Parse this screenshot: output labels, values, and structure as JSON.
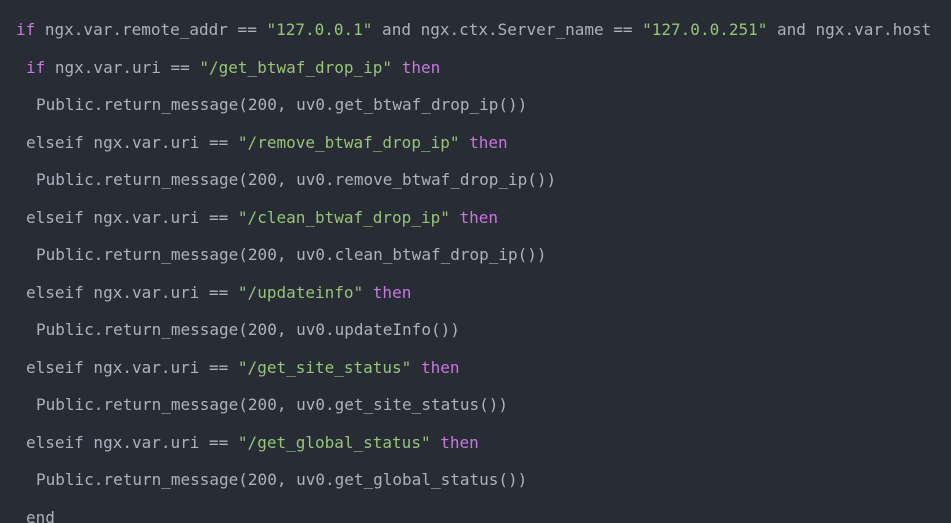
{
  "code": {
    "lines": [
      {
        "indent": 16,
        "tokens": [
          {
            "t": "kw",
            "v": "if"
          },
          {
            "t": "pl",
            "v": " ngx.var.remote_addr == "
          },
          {
            "t": "str",
            "v": "\"127.0.0.1\""
          },
          {
            "t": "pl",
            "v": " and ngx.ctx.Server_name == "
          },
          {
            "t": "str",
            "v": "\"127.0.0.251\""
          },
          {
            "t": "pl",
            "v": " and ngx.var.host"
          }
        ]
      },
      {
        "indent": 26,
        "tokens": [
          {
            "t": "kw",
            "v": "if"
          },
          {
            "t": "pl",
            "v": " ngx.var.uri == "
          },
          {
            "t": "str",
            "v": "\"/get_btwaf_drop_ip\""
          },
          {
            "t": "pl",
            "v": " "
          },
          {
            "t": "kw",
            "v": "then"
          }
        ]
      },
      {
        "indent": 36,
        "tokens": [
          {
            "t": "pl",
            "v": "Public.return_message(200, uv0.get_btwaf_drop_ip())"
          }
        ]
      },
      {
        "indent": 26,
        "tokens": [
          {
            "t": "pl",
            "v": "elseif ngx.var.uri == "
          },
          {
            "t": "str",
            "v": "\"/remove_btwaf_drop_ip\""
          },
          {
            "t": "pl",
            "v": " "
          },
          {
            "t": "kw",
            "v": "then"
          }
        ]
      },
      {
        "indent": 36,
        "tokens": [
          {
            "t": "pl",
            "v": "Public.return_message(200, uv0.remove_btwaf_drop_ip())"
          }
        ]
      },
      {
        "indent": 26,
        "tokens": [
          {
            "t": "pl",
            "v": "elseif ngx.var.uri == "
          },
          {
            "t": "str",
            "v": "\"/clean_btwaf_drop_ip\""
          },
          {
            "t": "pl",
            "v": " "
          },
          {
            "t": "kw",
            "v": "then"
          }
        ]
      },
      {
        "indent": 36,
        "tokens": [
          {
            "t": "pl",
            "v": "Public.return_message(200, uv0.clean_btwaf_drop_ip())"
          }
        ]
      },
      {
        "indent": 26,
        "tokens": [
          {
            "t": "pl",
            "v": "elseif ngx.var.uri == "
          },
          {
            "t": "str",
            "v": "\"/updateinfo\""
          },
          {
            "t": "pl",
            "v": " "
          },
          {
            "t": "kw",
            "v": "then"
          }
        ]
      },
      {
        "indent": 36,
        "tokens": [
          {
            "t": "pl",
            "v": "Public.return_message(200, uv0.updateInfo())"
          }
        ]
      },
      {
        "indent": 26,
        "tokens": [
          {
            "t": "pl",
            "v": "elseif ngx.var.uri == "
          },
          {
            "t": "str",
            "v": "\"/get_site_status\""
          },
          {
            "t": "pl",
            "v": " "
          },
          {
            "t": "kw",
            "v": "then"
          }
        ]
      },
      {
        "indent": 36,
        "tokens": [
          {
            "t": "pl",
            "v": "Public.return_message(200, uv0.get_site_status())"
          }
        ]
      },
      {
        "indent": 26,
        "tokens": [
          {
            "t": "pl",
            "v": "elseif ngx.var.uri == "
          },
          {
            "t": "str",
            "v": "\"/get_global_status\""
          },
          {
            "t": "pl",
            "v": " "
          },
          {
            "t": "kw",
            "v": "then"
          }
        ]
      },
      {
        "indent": 36,
        "tokens": [
          {
            "t": "pl",
            "v": "Public.return_message(200, uv0.get_global_status())"
          }
        ]
      },
      {
        "indent": 26,
        "tokens": [
          {
            "t": "pl",
            "v": "end"
          }
        ]
      }
    ]
  },
  "colors": {
    "background": "#282c34",
    "keyword": "#c678dd",
    "string": "#98c379",
    "plain": "#abb2bf"
  }
}
